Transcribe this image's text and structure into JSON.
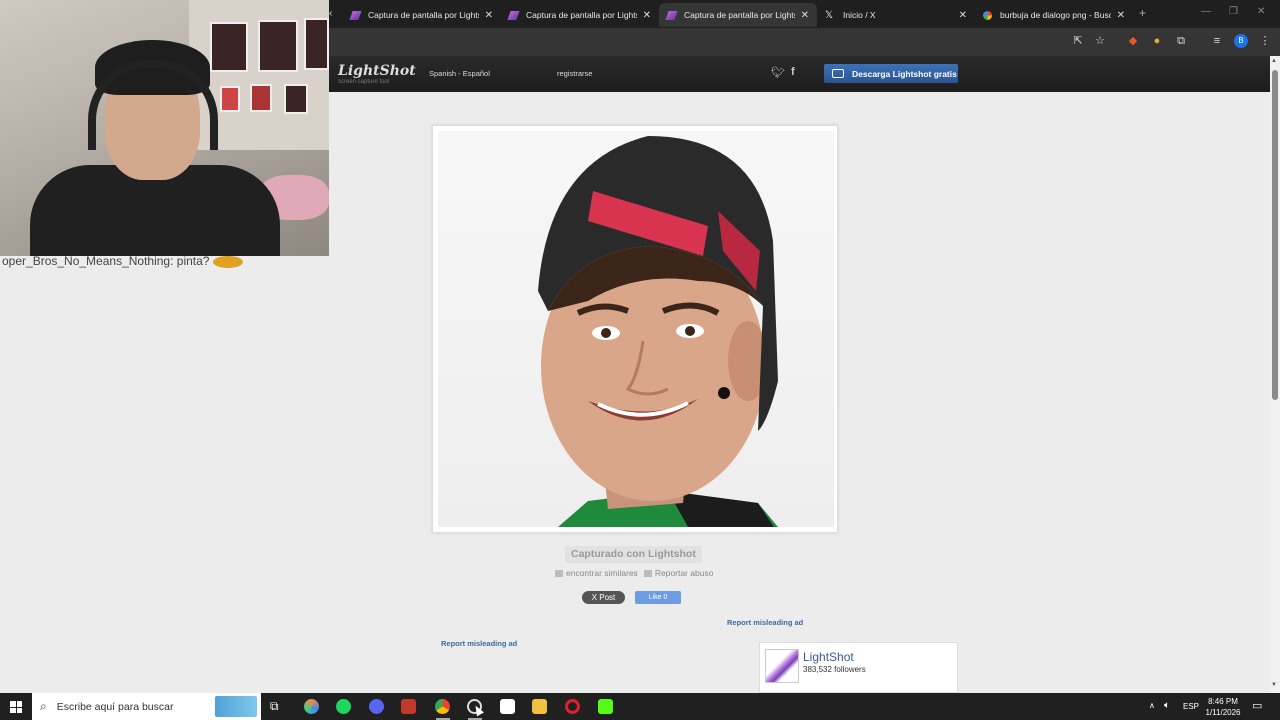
{
  "overlay": {
    "chat_text": "oper_Bros_No_Means_Nothing: pinta?"
  },
  "browser": {
    "tabs": [
      {
        "title": "Captura de pantalla por Lightshot",
        "icon": "lightshot-feather-icon"
      },
      {
        "title": "Captura de pantalla por Lightshot",
        "icon": "lightshot-feather-icon"
      },
      {
        "title": "Captura de pantalla por Lightshot",
        "icon": "lightshot-feather-icon",
        "active": true
      },
      {
        "title": "Inicio / X",
        "icon": "x-logo-icon"
      },
      {
        "title": "burbuja de dialogo png - Buscar",
        "icon": "google-icon"
      }
    ],
    "profile_initial": "B"
  },
  "lightshot": {
    "logo": "LightShot",
    "logo_sub": "screen capture tool",
    "language": "Spanish - Español",
    "register": "registrarse",
    "download_button": "Descarga Lightshot gratis",
    "caption": "Capturado con Lightshot",
    "find_similar": "encontrar similares",
    "report_abuse": "Reportar abuso",
    "post_button": "X Post",
    "like_button": "Like 0",
    "report_ad_right": "Report misleading ad",
    "report_ad_left": "Report misleading ad",
    "fb_page_name": "LightShot",
    "fb_followers": "383,532 followers"
  },
  "taskbar": {
    "search_placeholder": "Escribe aquí para buscar",
    "language": "ESP",
    "time": "8:46 PM",
    "date": "1/11/2026"
  }
}
